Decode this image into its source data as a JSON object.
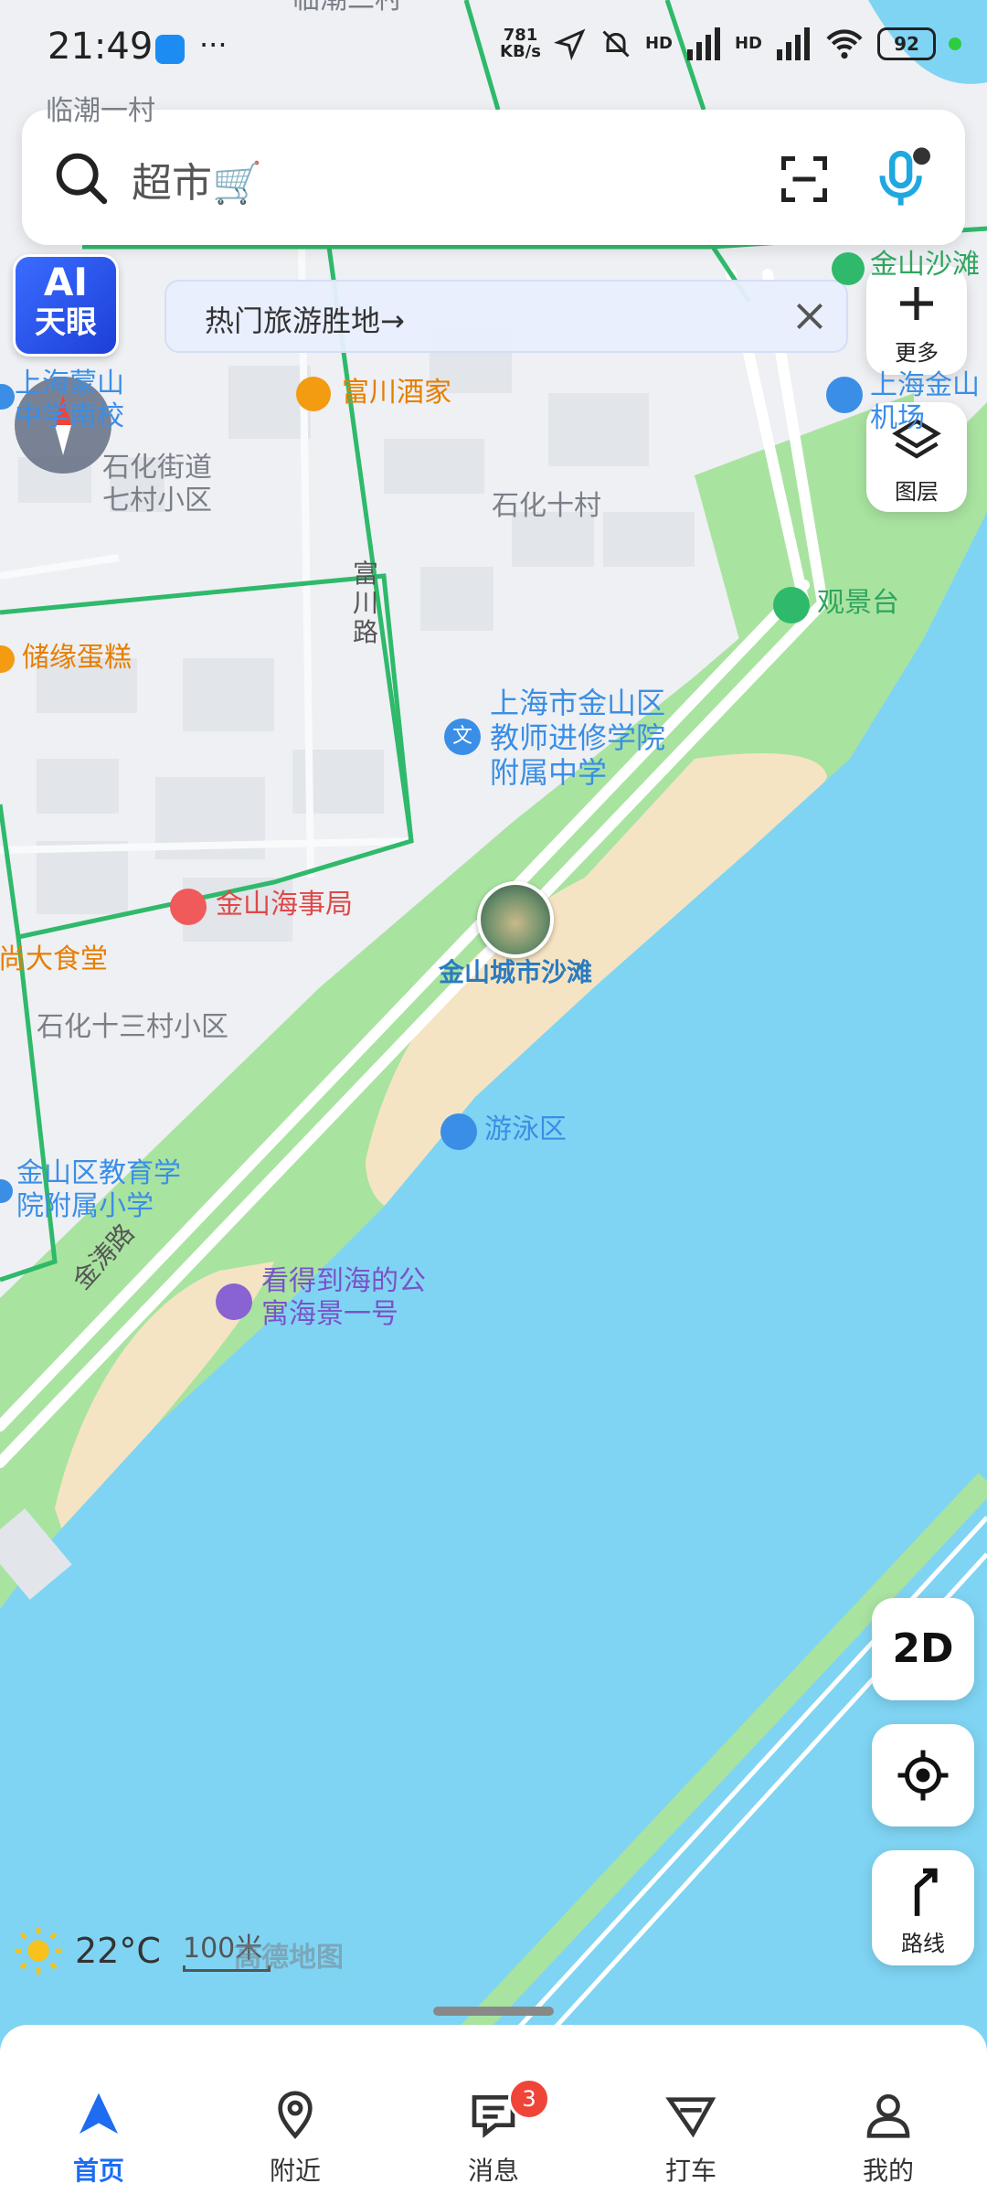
{
  "status_bar": {
    "time": "21:49",
    "more": "···",
    "speed_value": "781",
    "speed_unit": "KB/s",
    "battery": "92",
    "hd1": "HD",
    "hd2": "HD"
  },
  "search": {
    "placeholder": "超市🛒",
    "icons": [
      "search-icon",
      "scan-icon",
      "voice-icon"
    ]
  },
  "ai_button": {
    "line1": "AI",
    "line2": "天眼"
  },
  "banner": {
    "text": "热门旅游胜地→"
  },
  "side_buttons": {
    "more": "更多",
    "layers": "图层"
  },
  "map": {
    "pois": {
      "hotel_restaurant": "富川酒家",
      "school_top": "上海蒙山\n中学南校",
      "community1": "石化街道\n七村小区",
      "community2": "石化十村",
      "road_fuchuan": "富川路",
      "cake": "储缘蛋糕",
      "viewpoint": "观景台",
      "airport": "上海金山\n机场",
      "school_main": "上海市金山区\n教师进修学院\n附属中学",
      "maritime": "金山海事局",
      "canteen": "尚大食堂",
      "community3": "石化十三村小区",
      "beach": "金山城市沙滩",
      "swim": "游泳区",
      "primary_school": "金山区教育学\n院附属小学",
      "road_jintao": "金涛路",
      "apartment": "看得到海的公\n寓海景一号",
      "top_partial": "临潮二村",
      "top_partial2": "临潮一村",
      "top_right": "金山沙滩"
    }
  },
  "map_controls": {
    "view_mode": "2D",
    "route": "路线"
  },
  "weather": {
    "temp": "22°C"
  },
  "scale": {
    "text": "100米",
    "brand": "高德地图"
  },
  "bottom_nav": {
    "items": [
      {
        "label": "首页",
        "icon": "navigate-arrow-icon",
        "active": true
      },
      {
        "label": "附近",
        "icon": "location-pin-icon",
        "active": false
      },
      {
        "label": "消息",
        "icon": "message-icon",
        "active": false,
        "badge": "3"
      },
      {
        "label": "打车",
        "icon": "taxi-icon",
        "active": false
      },
      {
        "label": "我的",
        "icon": "profile-icon",
        "active": false
      }
    ]
  },
  "colors": {
    "water": "#7fd4f3",
    "park": "#a9e3a0",
    "sand": "#f5e4c3",
    "road_green": "#2fb96b",
    "accent_blue": "#1d6cf2"
  }
}
